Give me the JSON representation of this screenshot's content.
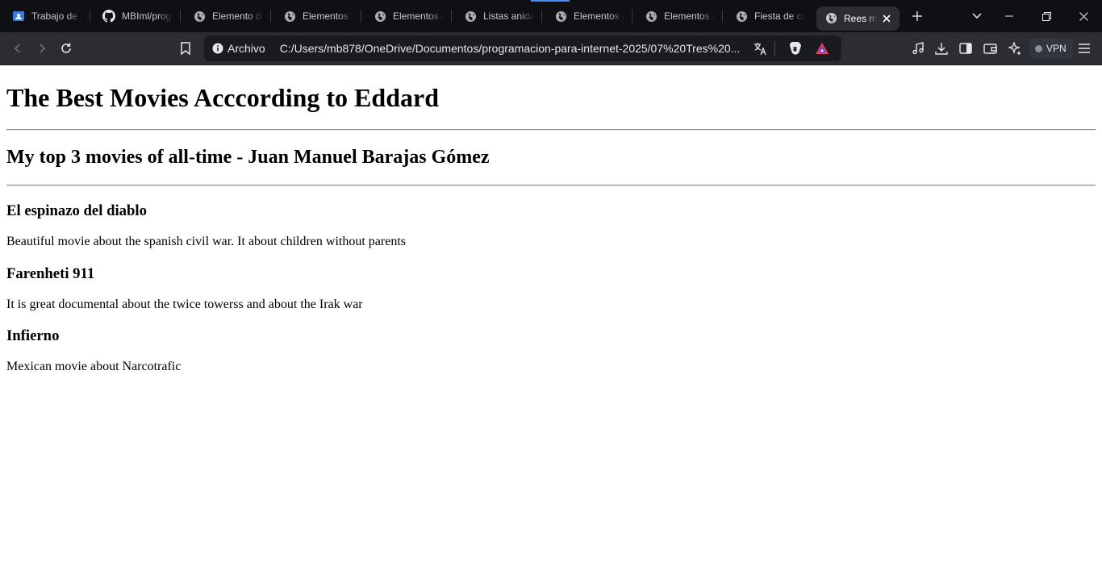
{
  "browser": {
    "tabs": [
      {
        "label": "Trabajo de c",
        "icon": "classroom-icon"
      },
      {
        "label": "MBIml/prog",
        "icon": "github-icon"
      },
      {
        "label": "Elemento de",
        "icon": "globe-icon"
      },
      {
        "label": "Elementos b",
        "icon": "globe-icon"
      },
      {
        "label": "Elementos c",
        "icon": "globe-icon"
      },
      {
        "label": "Listas anida",
        "icon": "globe-icon"
      },
      {
        "label": "Elementos p",
        "icon": "globe-icon"
      },
      {
        "label": "Elementos ir",
        "icon": "globe-icon"
      },
      {
        "label": "Fiesta de cu",
        "icon": "globe-icon"
      },
      {
        "label": "Rees m",
        "icon": "globe-icon",
        "active": true
      }
    ],
    "address_bar": {
      "scheme_label": "Archivo",
      "url": "C:/Users/mb878/OneDrive/Documentos/programacion-para-internet-2025/07%20Tres%20..."
    },
    "vpn_label": "VPN",
    "colors": {
      "tab_bg": "#0f1014",
      "toolbar_bg": "#2b2d33",
      "urlbar_bg": "#1a1b1f",
      "accent": "#4a8df8",
      "brave_lion": "#e8e8ea",
      "rewards_red": "#e83e5a"
    }
  },
  "page": {
    "title": "The Best Movies Acccording to Eddard",
    "subtitle": "My top 3 movies of all-time - Juan Manuel Barajas Gómez",
    "movies": [
      {
        "title": "El espinazo del diablo",
        "description": "Beautiful movie about the spanish civil war. It about children without parents"
      },
      {
        "title": "Farenheti 911",
        "description": "It is great documental about the twice towerss and about the Irak war"
      },
      {
        "title": "Infierno",
        "description": "Mexican movie about Narcotrafic"
      }
    ]
  }
}
